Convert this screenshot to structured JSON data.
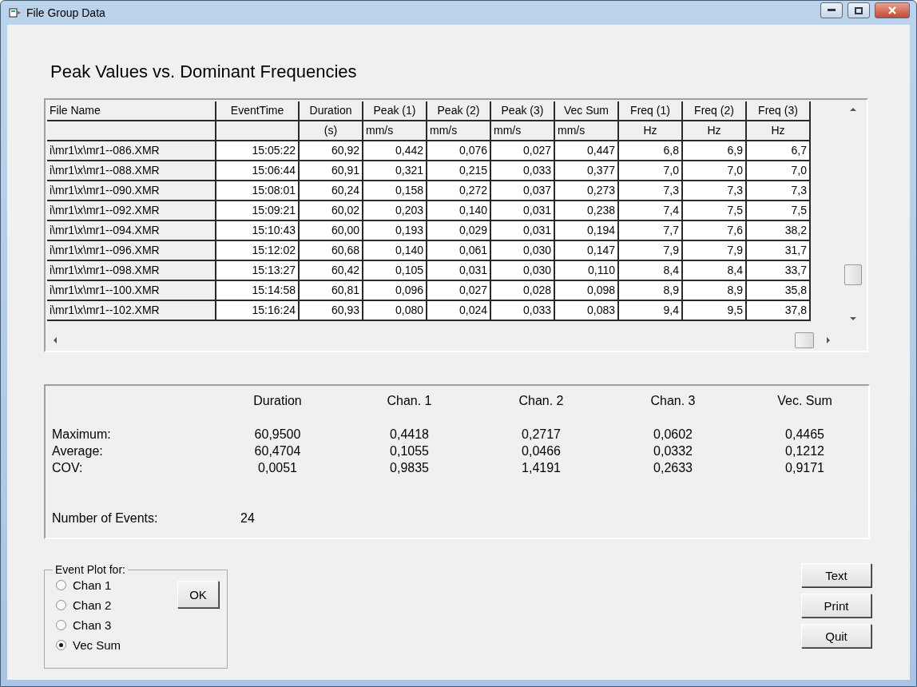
{
  "window": {
    "title": "File Group Data"
  },
  "heading": "Peak Values vs. Dominant Frequencies",
  "table": {
    "columns": [
      {
        "label": "File Name"
      },
      {
        "label": "EventTime"
      },
      {
        "label": "Duration",
        "unit": "(s)"
      },
      {
        "label": "Peak (1)",
        "unit": "mm/s"
      },
      {
        "label": "Peak (2)",
        "unit": "mm/s"
      },
      {
        "label": "Peak (3)",
        "unit": "mm/s"
      },
      {
        "label": "Vec Sum",
        "unit": "mm/s"
      },
      {
        "label": "Freq (1)",
        "unit": "Hz"
      },
      {
        "label": "Freq (2)",
        "unit": "Hz"
      },
      {
        "label": "Freq (3)",
        "unit": "Hz"
      }
    ],
    "rows": [
      [
        "i\\mr1\\x\\mr1--086.XMR",
        "15:05:22",
        "60,92",
        "0,442",
        "0,076",
        "0,027",
        "0,447",
        "6,8",
        "6,9",
        "6,7"
      ],
      [
        "i\\mr1\\x\\mr1--088.XMR",
        "15:06:44",
        "60,91",
        "0,321",
        "0,215",
        "0,033",
        "0,377",
        "7,0",
        "7,0",
        "7,0"
      ],
      [
        "i\\mr1\\x\\mr1--090.XMR",
        "15:08:01",
        "60,24",
        "0,158",
        "0,272",
        "0,037",
        "0,273",
        "7,3",
        "7,3",
        "7,3"
      ],
      [
        "i\\mr1\\x\\mr1--092.XMR",
        "15:09:21",
        "60,02",
        "0,203",
        "0,140",
        "0,031",
        "0,238",
        "7,4",
        "7,5",
        "7,5"
      ],
      [
        "i\\mr1\\x\\mr1--094.XMR",
        "15:10:43",
        "60,00",
        "0,193",
        "0,029",
        "0,031",
        "0,194",
        "7,7",
        "7,6",
        "38,2"
      ],
      [
        "i\\mr1\\x\\mr1--096.XMR",
        "15:12:02",
        "60,68",
        "0,140",
        "0,061",
        "0,030",
        "0,147",
        "7,9",
        "7,9",
        "31,7"
      ],
      [
        "i\\mr1\\x\\mr1--098.XMR",
        "15:13:27",
        "60,42",
        "0,105",
        "0,031",
        "0,030",
        "0,110",
        "8,4",
        "8,4",
        "33,7"
      ],
      [
        "i\\mr1\\x\\mr1--100.XMR",
        "15:14:58",
        "60,81",
        "0,096",
        "0,027",
        "0,028",
        "0,098",
        "8,9",
        "8,9",
        "35,8"
      ],
      [
        "i\\mr1\\x\\mr1--102.XMR",
        "15:16:24",
        "60,93",
        "0,080",
        "0,024",
        "0,033",
        "0,083",
        "9,4",
        "9,5",
        "37,8"
      ]
    ]
  },
  "stats": {
    "columns": [
      "Duration",
      "Chan. 1",
      "Chan. 2",
      "Chan. 3",
      "Vec. Sum"
    ],
    "rows": [
      {
        "label": "Maximum:",
        "values": [
          "60,9500",
          "0,4418",
          "0,2717",
          "0,0602",
          "0,4465"
        ]
      },
      {
        "label": "Average:",
        "values": [
          "60,4704",
          "0,1055",
          "0,0466",
          "0,0332",
          "0,1212"
        ]
      },
      {
        "label": "COV:",
        "values": [
          "0,0051",
          "0,9835",
          "1,4191",
          "0,2633",
          "0,9171"
        ]
      }
    ],
    "events_label": "Number of Events:",
    "events_value": "24"
  },
  "event_plot": {
    "title": "Event Plot for:",
    "options": [
      {
        "label": "Chan 1",
        "selected": false
      },
      {
        "label": "Chan 2",
        "selected": false
      },
      {
        "label": "Chan 3",
        "selected": false
      },
      {
        "label": "Vec Sum",
        "selected": true
      }
    ],
    "ok_button": "OK"
  },
  "buttons": [
    "Text",
    "Print",
    "Quit"
  ]
}
